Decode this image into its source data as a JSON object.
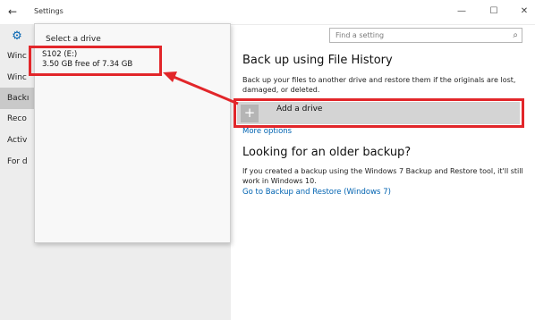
{
  "titlebar": {
    "back_glyph": "←",
    "title": "Settings",
    "minimize_glyph": "—",
    "maximize_glyph": "☐",
    "close_glyph": "✕"
  },
  "sidebar": {
    "icon": "gear-icon",
    "items": [
      {
        "label": "Winc"
      },
      {
        "label": "Winc"
      },
      {
        "label": "Backı"
      },
      {
        "label": "Reco"
      },
      {
        "label": "Activ"
      },
      {
        "label": "For d"
      }
    ]
  },
  "flyout": {
    "title": "Select a drive",
    "drive_name": "S102 (E:)",
    "drive_free": "3.50 GB free of 7.34 GB"
  },
  "search": {
    "placeholder": "Find a setting",
    "icon": "search-icon"
  },
  "main": {
    "heading": "Back up using File History",
    "description": "Back up your files to another drive and restore them if the originals are lost, damaged, or deleted.",
    "add_drive_label": "Add a drive",
    "add_drive_icon": "plus-icon",
    "more_options": "More options",
    "heading2": "Looking for an older backup?",
    "description2": "If you created a backup using the Windows 7 Backup and Restore tool, it'll still work in Windows 10.",
    "restore_link": "Go to Backup and Restore (Windows 7)"
  },
  "colors": {
    "accent": "#0063b1",
    "highlight": "#e2262a",
    "sidebar_bg": "#ededed"
  }
}
